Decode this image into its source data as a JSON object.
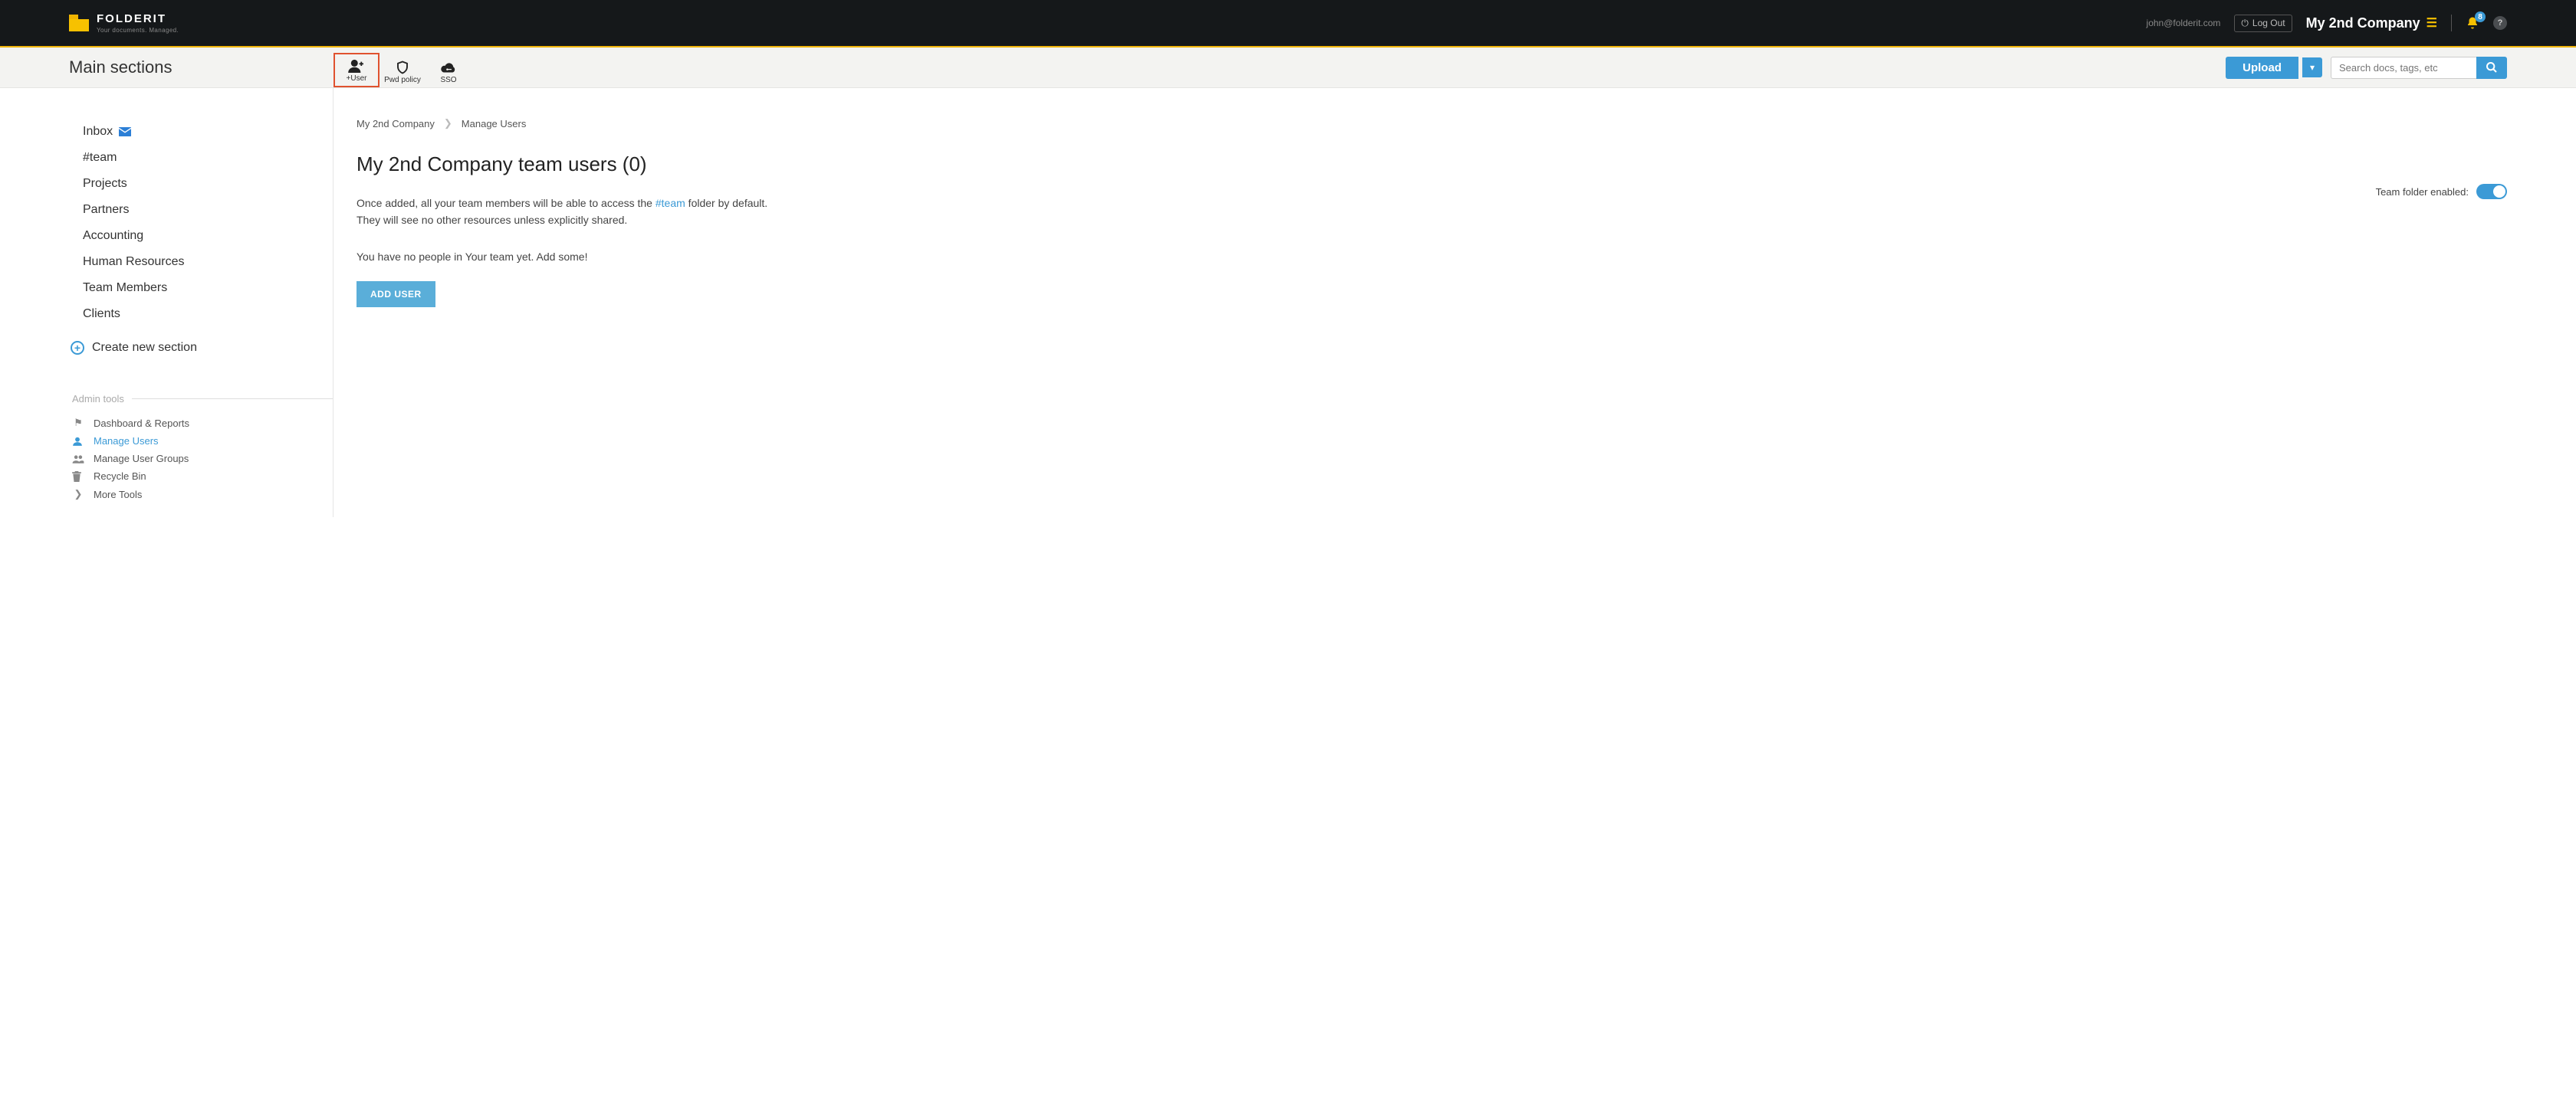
{
  "brand": {
    "name": "FOLDERIT",
    "tagline": "Your documents. Managed."
  },
  "header": {
    "email": "john@folderit.com",
    "logout": "Log Out",
    "company": "My 2nd Company",
    "notifications_count": "8"
  },
  "actionbar": {
    "title": "Main sections",
    "tools": {
      "add_user": "+User",
      "pwd_policy": "Pwd policy",
      "sso": "SSO"
    },
    "upload_label": "Upload",
    "search_placeholder": "Search docs, tags, etc"
  },
  "sidebar": {
    "items": [
      {
        "label": "Inbox"
      },
      {
        "label": "#team"
      },
      {
        "label": "Projects"
      },
      {
        "label": "Partners"
      },
      {
        "label": "Accounting"
      },
      {
        "label": "Human Resources"
      },
      {
        "label": "Team Members"
      },
      {
        "label": "Clients"
      }
    ],
    "create_label": "Create new section",
    "admin_header": "Admin tools",
    "admin_items": [
      {
        "label": "Dashboard & Reports"
      },
      {
        "label": "Manage Users"
      },
      {
        "label": "Manage User Groups"
      },
      {
        "label": "Recycle Bin"
      },
      {
        "label": "More Tools"
      }
    ]
  },
  "breadcrumb": {
    "root": "My 2nd Company",
    "current": "Manage Users"
  },
  "page": {
    "title": "My 2nd Company team users (0)",
    "desc_a": "Once added, all your team members will be able to access the ",
    "desc_link": "#team",
    "desc_b": " folder by default.",
    "desc_line2": "They will see no other resources unless explicitly shared.",
    "empty": "You have no people in Your team yet. Add some!",
    "add_user_btn": "ADD USER",
    "toggle_label": "Team folder enabled:"
  }
}
